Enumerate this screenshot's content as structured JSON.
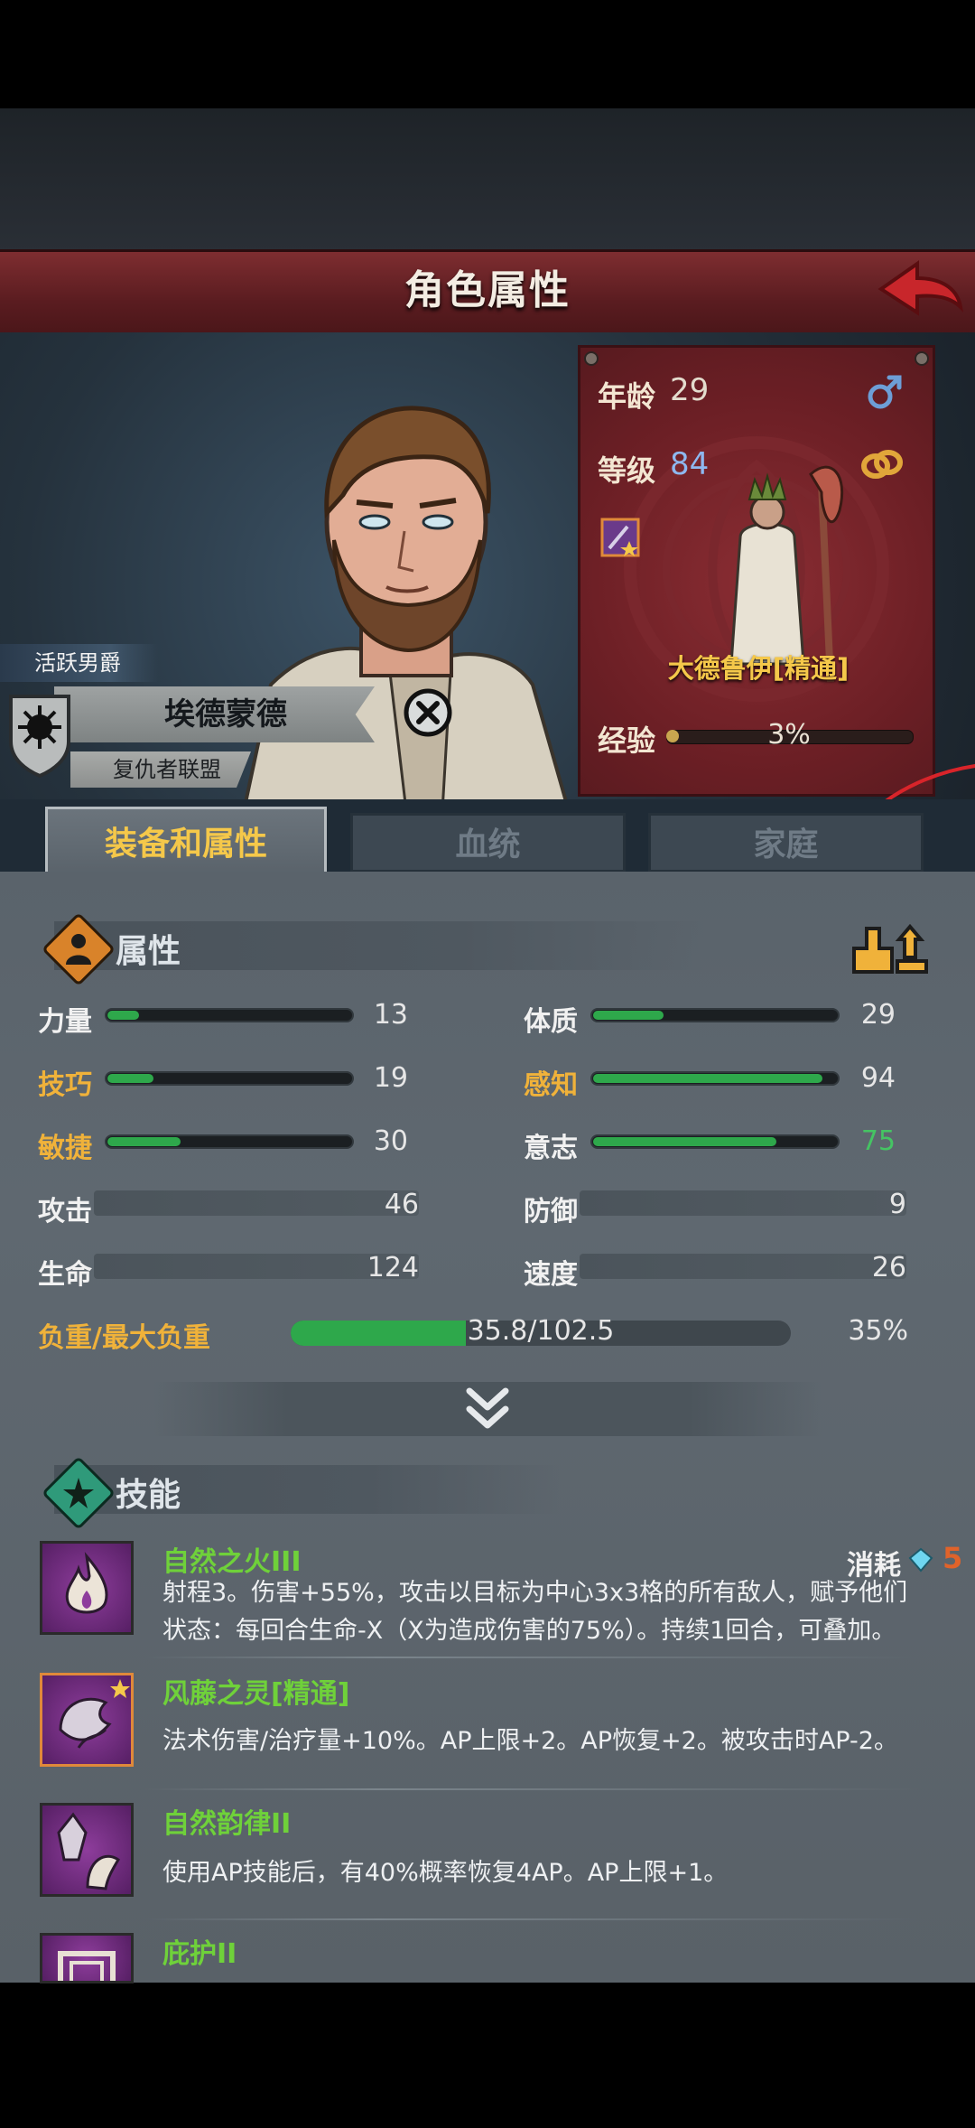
{
  "header": {
    "title": "角色属性"
  },
  "character": {
    "noble_title": "活跃男爵",
    "name": "埃德蒙德",
    "faction": "复仇者联盟"
  },
  "info": {
    "age_label": "年龄",
    "age": "29",
    "level_label": "等级",
    "level": "84",
    "class_name": "大德鲁伊[精通]",
    "exp_label": "经验",
    "exp_percent": "3%",
    "exp_fraction": 0.03
  },
  "tabs": [
    {
      "label": "装备和属性",
      "active": true
    },
    {
      "label": "血统",
      "active": false
    },
    {
      "label": "家庭",
      "active": false
    }
  ],
  "attributes": {
    "title": "属性",
    "stats_left": [
      {
        "label": "力量",
        "value": "13",
        "max": 100,
        "gold": false
      },
      {
        "label": "技巧",
        "value": "19",
        "max": 100,
        "gold": true
      },
      {
        "label": "敏捷",
        "value": "30",
        "max": 100,
        "gold": true
      }
    ],
    "stats_right": [
      {
        "label": "体质",
        "value": "29",
        "max": 100,
        "gold": false
      },
      {
        "label": "感知",
        "value": "94",
        "max": 100,
        "gold": true
      },
      {
        "label": "意志",
        "value": "75",
        "max": 100,
        "gold": false
      }
    ],
    "attack_label": "攻击",
    "attack": "46",
    "defense_label": "防御",
    "defense": "9",
    "hp_label": "生命",
    "hp": "124",
    "speed_label": "速度",
    "speed": "26",
    "load_label": "负重/最大负重",
    "load_text": "35.8/102.5",
    "load_percent": "35%",
    "load_fraction": 0.35
  },
  "skills": {
    "title": "技能",
    "consume_label": "消耗",
    "consume_value": "5",
    "items": [
      {
        "name": "自然之火III",
        "desc1": "射程3。伤害+55%，攻击以目标为中心3x3格的所有敌人，赋予他们",
        "desc2": "状态：每回合生命-X（X为造成伤害的75%）。持续1回合，可叠加。"
      },
      {
        "name": "风藤之灵[精通]",
        "desc1": "法术伤害/治疗量+10%。AP上限+2。AP恢复+2。被攻击时AP-2。",
        "desc2": ""
      },
      {
        "name": "自然韵律II",
        "desc1": "使用AP技能后，有40%概率恢复4AP。AP上限+1。",
        "desc2": ""
      },
      {
        "name": "庇护II",
        "desc1": "",
        "desc2": ""
      }
    ]
  },
  "icons": {
    "back": "back-arrow-icon",
    "male": "male-icon",
    "ring": "ring-icon",
    "close": "close-icon",
    "chevron": "chevron-down-icon",
    "upgrade": "upgrade-icon",
    "diamond": "diamond-icon"
  },
  "colors": {
    "header_red": "#7e2d30",
    "gold": "#f5c84a",
    "green": "#2ea84b",
    "skill_green": "#6fd13a",
    "level_blue": "#8eb8f0"
  }
}
